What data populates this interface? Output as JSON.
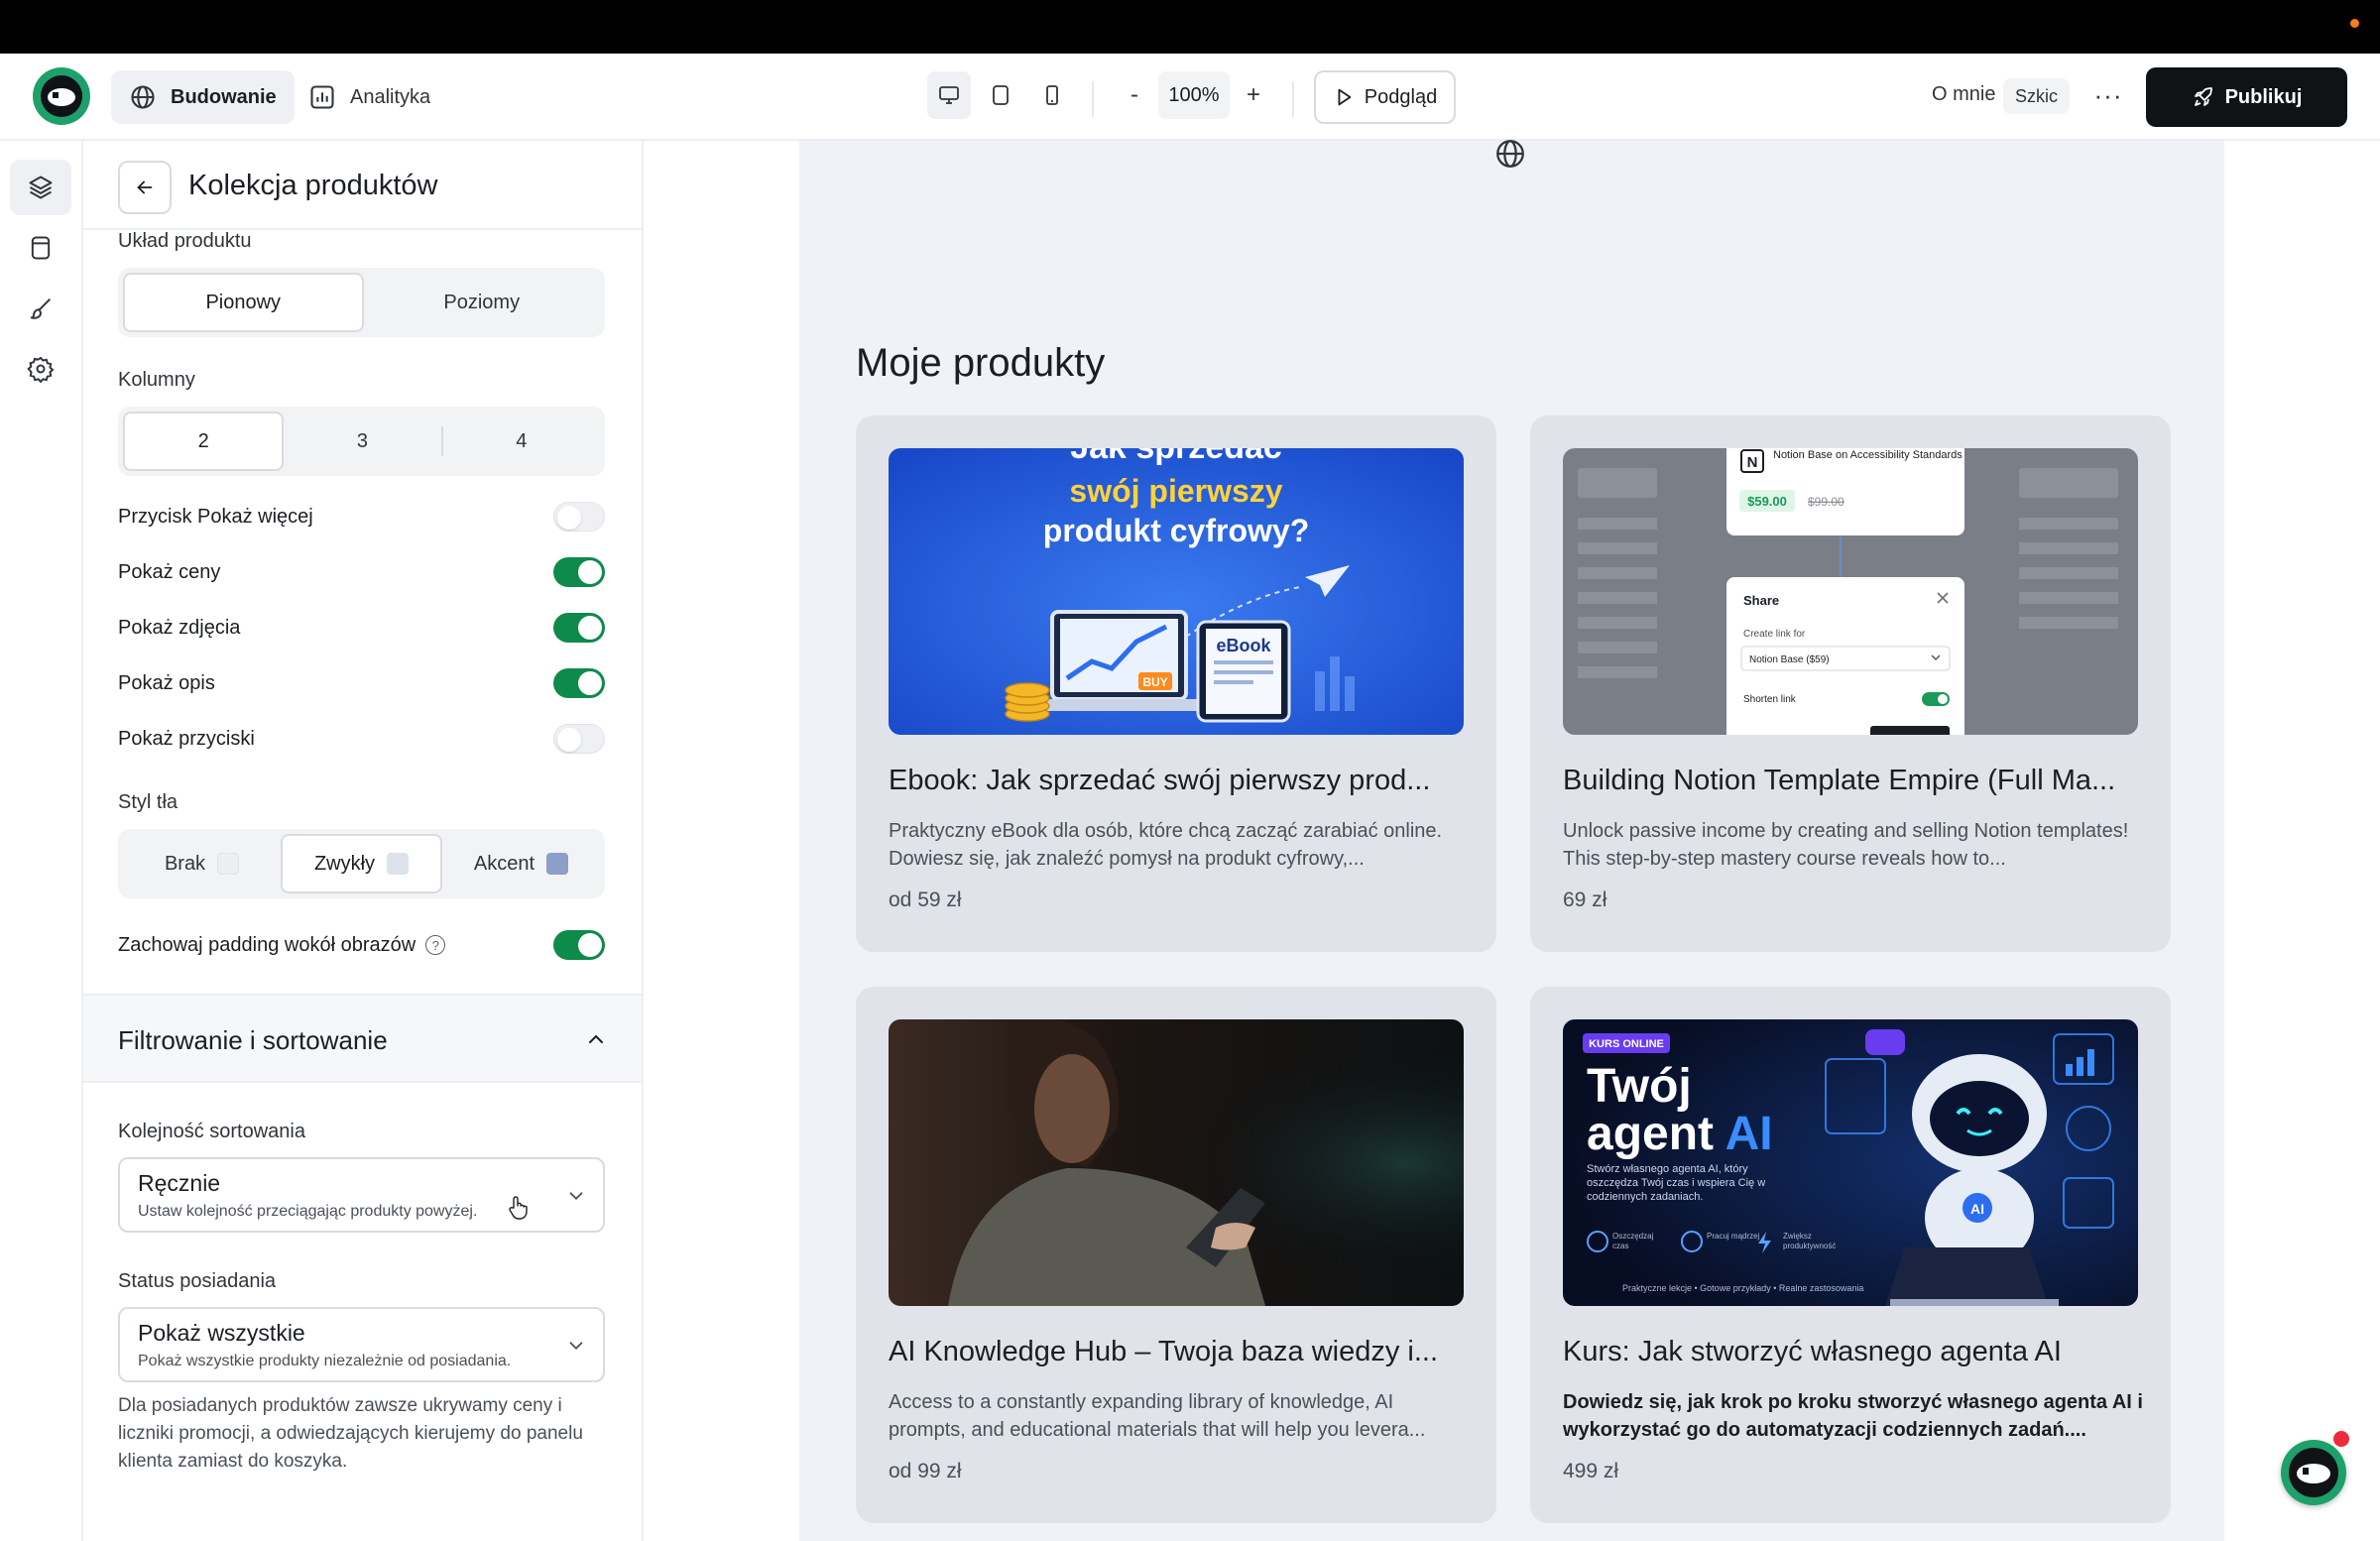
{
  "header": {
    "nav": [
      {
        "label": "Budowanie",
        "icon": "globe-icon",
        "active": true
      },
      {
        "label": "Analityka",
        "icon": "bar-chart-icon",
        "active": false
      }
    ],
    "zoom_minus": "-",
    "zoom_value": "100%",
    "zoom_plus": "+",
    "preview_label": "Podgląd",
    "about_label": "O mnie",
    "status_badge": "Szkic",
    "more_label": "···",
    "publish_label": "Publikuj"
  },
  "panel": {
    "title": "Kolekcja produktów",
    "layout_label": "Układ produktu",
    "layout_options": [
      "Pionowy",
      "Poziomy"
    ],
    "columns_label": "Kolumny",
    "columns_options": [
      "2",
      "3",
      "4"
    ],
    "toggles": [
      {
        "label": "Przycisk Pokaż więcej",
        "on": false
      },
      {
        "label": "Pokaż ceny",
        "on": true
      },
      {
        "label": "Pokaż zdjęcia",
        "on": true
      },
      {
        "label": "Pokaż opis",
        "on": true
      },
      {
        "label": "Pokaż przyciski",
        "on": false
      }
    ],
    "bg_style_label": "Styl tła",
    "bg_options": [
      {
        "label": "Brak",
        "swatch": "#f2f3f5"
      },
      {
        "label": "Zwykły",
        "swatch": "#dde2ea"
      },
      {
        "label": "Akcent",
        "swatch": "#8b9fc8"
      }
    ],
    "padding_label": "Zachowaj padding wokół obrazów",
    "padding_help": "?",
    "padding_on": true,
    "filter_section_title": "Filtrowanie i sortowanie",
    "sort_label": "Kolejność sortowania",
    "sort_value": "Ręcznie",
    "sort_hint": "Ustaw kolejność przeciągając produkty powyżej.",
    "owner_label": "Status posiadania",
    "owner_value": "Pokaż wszystkie",
    "owner_hint": "Pokaż wszystkie produkty niezależnie od posiadania.",
    "note": "Dla posiadanych produktów zawsze ukrywamy ceny i liczniki promocji, a odwiedzających kierujemy do panelu klienta zamiast do koszyka."
  },
  "canvas": {
    "section_title": "Moje produkty",
    "products": [
      {
        "title": "Ebook: Jak sprzedać swój pierwszy prod...",
        "desc": "Praktyczny eBook dla osób, które chcą zacząć zarabiać online. Dowiesz się, jak znaleźć pomysł na produkt cyfrowy,...",
        "price": "od 59 zł",
        "bold_desc": false,
        "img": {
          "heading_top": "Jak sprzedać",
          "heading_mid": "swój pierwszy",
          "heading_bot": "produkt cyfrowy?",
          "ebook": "eBook",
          "buy": "BUY"
        }
      },
      {
        "title": "Building Notion Template Empire (Full Ma...",
        "desc": "Unlock passive income by creating and selling Notion templates! This step-by-step mastery course reveals how to...",
        "price": "69 zł",
        "bold_desc": false,
        "img": {
          "notion_name": "Notion Base on Accessibility Standards",
          "price_new": "$59.00",
          "price_old": "$99.00",
          "share": "Share",
          "create_link": "Create link for",
          "select": "Notion Base ($59)",
          "shorten": "Shorten link"
        }
      },
      {
        "title": "AI Knowledge Hub – Twoja baza wiedzy i...",
        "desc": "Access to a constantly expanding library of knowledge, AI prompts, and educational materials that will help you levera...",
        "price": "od 99 zł",
        "bold_desc": false,
        "img": {}
      },
      {
        "title": "Kurs: Jak stworzyć własnego agenta AI",
        "desc": "Dowiedz się, jak krok po kroku stworzyć własnego agenta AI i wykorzystać go do automatyzacji codziennych zadań....",
        "price": "499 zł",
        "bold_desc": true,
        "img": {
          "tag": "KURS ONLINE",
          "line1": "Twój",
          "line2a": "agent ",
          "line2b": "AI",
          "sub": "Stwórz własnego agenta AI, który oszczędza Twój czas i wspiera Cię w codziennych zadaniach.",
          "f1": "Oszczędzaj czas",
          "f2": "Pracuj mądrzej",
          "f3": "Zwiększ produktywność",
          "footer": "Praktyczne lekcje • Gotowe przykłady • Realne zastosowania",
          "robot_badge": "AI"
        }
      }
    ]
  },
  "colors": {
    "accent_green": "#0e8a4b",
    "brand_green": "#1ea06a",
    "publish_bg": "#0f1316"
  }
}
